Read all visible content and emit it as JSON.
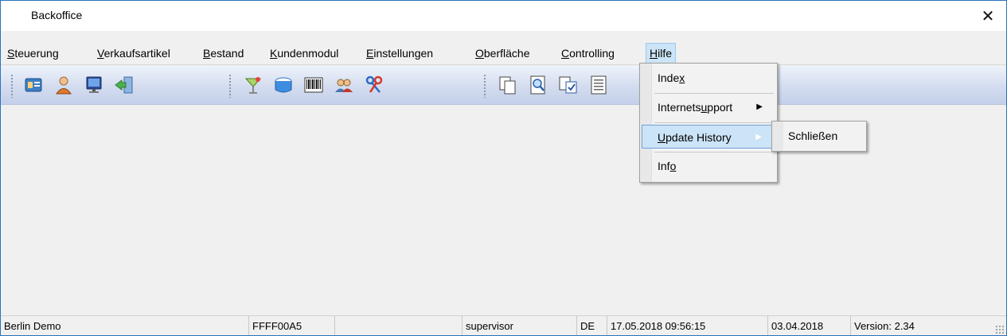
{
  "window": {
    "title": "Backoffice",
    "close_glyph": "✕"
  },
  "menubar": {
    "items": [
      {
        "prefix": "",
        "ul": "S",
        "rest": "teuerung"
      },
      {
        "prefix": "",
        "ul": "V",
        "rest": "erkaufsartikel"
      },
      {
        "prefix": "",
        "ul": "B",
        "rest": "estand"
      },
      {
        "prefix": "",
        "ul": "K",
        "rest": "undenmodul"
      },
      {
        "prefix": "",
        "ul": "E",
        "rest": "instellungen"
      },
      {
        "prefix": "",
        "ul": "O",
        "rest": "berfläche"
      },
      {
        "prefix": "",
        "ul": "C",
        "rest": "ontrolling"
      },
      {
        "prefix": "",
        "ul": "H",
        "rest": "ilfe"
      }
    ]
  },
  "toolbar": {
    "icons": [
      "customer-card-icon",
      "user-icon",
      "monitor-icon",
      "exit-door-icon",
      "cocktail-icon",
      "box-icon",
      "barcode-icon",
      "users-group-icon",
      "keys-icon",
      "document-copy-icon",
      "preview-icon",
      "checklist-icon",
      "text-document-icon"
    ]
  },
  "hilfe_menu": {
    "items": [
      {
        "prefix": "Inde",
        "ul": "x",
        "rest": ""
      },
      {
        "prefix": "Internets",
        "ul": "u",
        "rest": "pport"
      },
      {
        "prefix": "",
        "ul": "U",
        "rest": "pdate History"
      },
      {
        "prefix": "Inf",
        "ul": "o",
        "rest": ""
      }
    ],
    "submenu_arrow": "▶"
  },
  "submenu": {
    "item": "Schließen"
  },
  "statusbar": {
    "location": "Berlin Demo",
    "code": "FFFF00A5",
    "empty": "",
    "user": "supervisor",
    "lang": "DE",
    "datetime": "17.05.2018 09:56:15",
    "date": "03.04.2018",
    "version": "Version: 2.34"
  },
  "colors": {
    "highlight": "#cce4f7",
    "border": "#2b73b9"
  }
}
